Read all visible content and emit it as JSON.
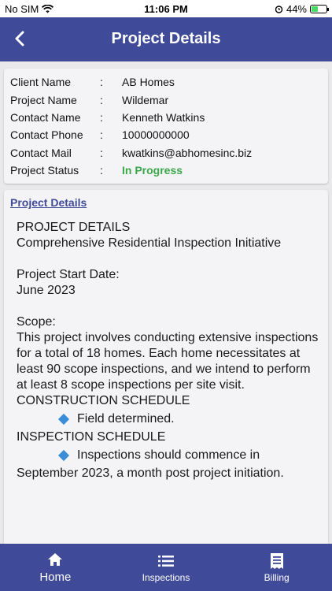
{
  "status_bar": {
    "carrier": "No SIM",
    "time": "11:06 PM",
    "battery": "44%",
    "battery_level": 0.44
  },
  "header": {
    "title": "Project Details"
  },
  "info": [
    {
      "label": "Client Name",
      "value": "AB Homes"
    },
    {
      "label": "Project Name",
      "value": "Wildemar"
    },
    {
      "label": "Contact Name",
      "value": "Kenneth Watkins"
    },
    {
      "label": "Contact Phone",
      "value": "10000000000"
    },
    {
      "label": "Contact Mail",
      "value": "kwatkins@abhomesinc.biz"
    },
    {
      "label": "Project Status",
      "value": "In Progress"
    }
  ],
  "separator": ":",
  "details": {
    "heading": "Project Details",
    "title_line": "PROJECT DETAILS",
    "subtitle": "Comprehensive Residential Inspection Initiative",
    "start_label": "Project Start Date:",
    "start_value": "June 2023",
    "scope_label": "Scope:",
    "scope_text": "This project involves conducting extensive inspections for a total of 18 homes. Each home necessitates at least 90 scope inspections, and we intend to perform at least 8 scope inspections per site visit.",
    "construction_label": "CONSTRUCTION SCHEDULE",
    "construction_bullet": "Field determined.",
    "inspection_label": "INSPECTION SCHEDULE",
    "inspection_bullet": "Inspections should commence in",
    "inspection_cont": "September 2023, a month post project initiation."
  },
  "tabs": [
    {
      "label": "Home",
      "icon": "home-icon"
    },
    {
      "label": "Inspections",
      "icon": "list-icon"
    },
    {
      "label": "Billing",
      "icon": "receipt-icon"
    }
  ],
  "colors": {
    "primary": "#3f4a99",
    "status_green": "#3aa84a",
    "bullet_blue": "#3a8ed8"
  }
}
